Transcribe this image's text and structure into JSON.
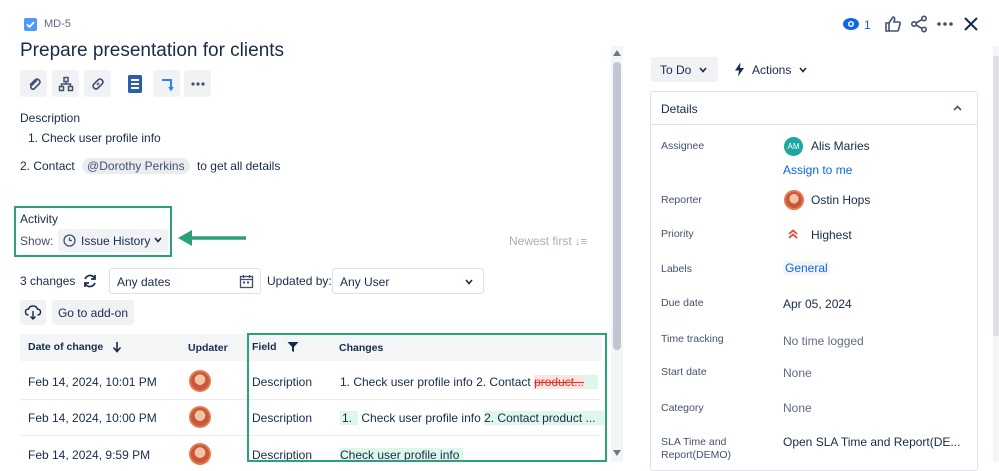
{
  "header": {
    "issue_key": "MD-5",
    "title": "Prepare presentation for clients",
    "watch_count": "1"
  },
  "description": {
    "heading": "Description",
    "item1": "1. Check user profile info",
    "item2_prefix": "2. Contact",
    "mention": "@Dorothy Perkins",
    "item2_suffix": "to get all details"
  },
  "activity": {
    "heading": "Activity",
    "show_label": "Show:",
    "show_value": "Issue History",
    "sort_label": "Newest first"
  },
  "history_filters": {
    "changes_count": "3 changes",
    "dates_value": "Any dates",
    "updated_by_label": "Updated by:",
    "user_value": "Any User",
    "addon_button": "Go to add-on"
  },
  "history_table": {
    "columns": [
      "Date of change",
      "Updater",
      "Field",
      "Changes"
    ],
    "rows": [
      {
        "date": "Feb 14, 2024, 10:01 PM",
        "field": "Description",
        "change_plain": "1. Check user profile info 2. Contact ",
        "change_removed": "product...",
        "change_added": ""
      },
      {
        "date": "Feb 14, 2024, 10:00 PM",
        "field": "Description",
        "change_prefix": "1.",
        "change_plain": "Check user profile info",
        "change_added": "2. Contact product ..."
      },
      {
        "date": "Feb 14, 2024, 9:59 PM",
        "field": "Description",
        "change_added": "Check user profile info"
      }
    ]
  },
  "status": {
    "status_button": "To Do",
    "actions_button": "Actions"
  },
  "details": {
    "heading": "Details",
    "fields": [
      {
        "label": "Assignee",
        "value": "Alis Maries",
        "initials": "AM"
      },
      {
        "label": "",
        "value": "Assign to me"
      },
      {
        "label": "Reporter",
        "value": "Ostin Hops"
      },
      {
        "label": "Priority",
        "value": "Highest"
      },
      {
        "label": "Labels",
        "value": "General"
      },
      {
        "label": "Due date",
        "value": "Apr 05, 2024"
      },
      {
        "label": "Time tracking",
        "value": "No time logged"
      },
      {
        "label": "Start date",
        "value": "None"
      },
      {
        "label": "Category",
        "value": "None"
      },
      {
        "label": "SLA Time and Report(DEMO)",
        "value": "Open SLA Time and Report(DE..."
      }
    ]
  },
  "colors": {
    "accent": "#0c66e4",
    "highlight_box": "#2aa17a",
    "priority": "#e5493a"
  }
}
